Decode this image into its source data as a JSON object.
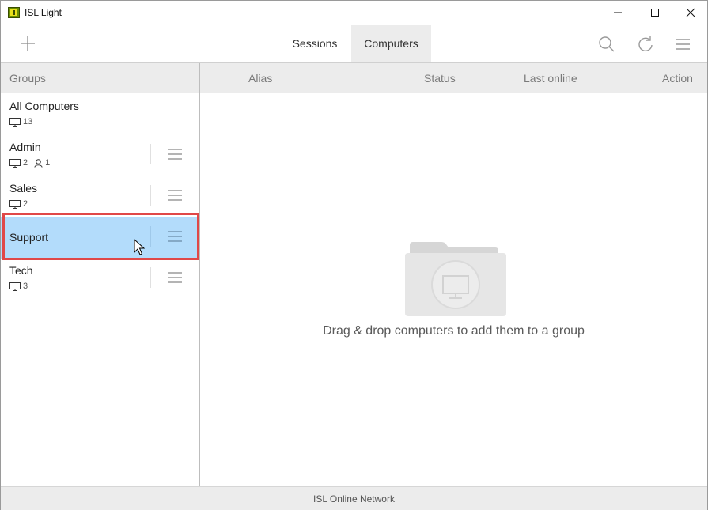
{
  "window": {
    "title": "ISL Light"
  },
  "toolbar": {
    "tabs": [
      {
        "label": "Sessions"
      },
      {
        "label": "Computers"
      }
    ]
  },
  "sidebar": {
    "header": "Groups",
    "groups": [
      {
        "name": "All Computers",
        "computers": "13",
        "users": ""
      },
      {
        "name": "Admin",
        "computers": "2",
        "users": "1"
      },
      {
        "name": "Sales",
        "computers": "2",
        "users": ""
      },
      {
        "name": "Support",
        "computers": "",
        "users": ""
      },
      {
        "name": "Tech",
        "computers": "3",
        "users": ""
      }
    ]
  },
  "main": {
    "columns": [
      "Alias",
      "Status",
      "Last online",
      "Action"
    ],
    "empty_message": "Drag & drop computers to add them to a group"
  },
  "statusbar": {
    "text": "ISL Online Network"
  },
  "colors": {
    "selected": "#b3dcfb",
    "highlight": "#e04848",
    "header_bg": "#ececec"
  }
}
